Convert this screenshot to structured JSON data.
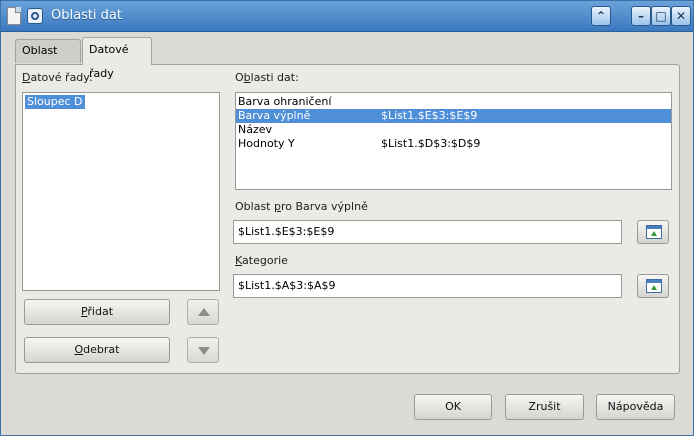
{
  "window": {
    "title": "Oblasti dat"
  },
  "tabs": [
    {
      "label": "Oblast dat"
    },
    {
      "label": "Datové řady"
    }
  ],
  "series_panel": {
    "label_first": "D",
    "label_rest": "atové řady:",
    "items": [
      "Sloupec D"
    ]
  },
  "ranges_panel": {
    "label_first": "O",
    "label_u": "b",
    "label_rest": "lasti dat:",
    "rows": [
      {
        "name": "Barva ohraničení",
        "value": ""
      },
      {
        "name": "Barva výplně",
        "value": "$List1.$E$3:$E$9"
      },
      {
        "name": "Název",
        "value": ""
      },
      {
        "name": "Hodnoty Y",
        "value": "$List1.$D$3:$D$9"
      }
    ]
  },
  "range_for": {
    "label_pre": "Oblast ",
    "label_u": "p",
    "label_post": "ro Barva výplně",
    "value": "$List1.$E$3:$E$9"
  },
  "categories": {
    "label_u": "K",
    "label_rest": "ategorie",
    "value": "$List1.$A$3:$A$9"
  },
  "buttons": {
    "add_u": "P",
    "add_rest": "řidat",
    "remove_u": "O",
    "remove_rest": "debrat",
    "ok": "OK",
    "cancel": "Zrušit",
    "help": "Nápověda"
  }
}
